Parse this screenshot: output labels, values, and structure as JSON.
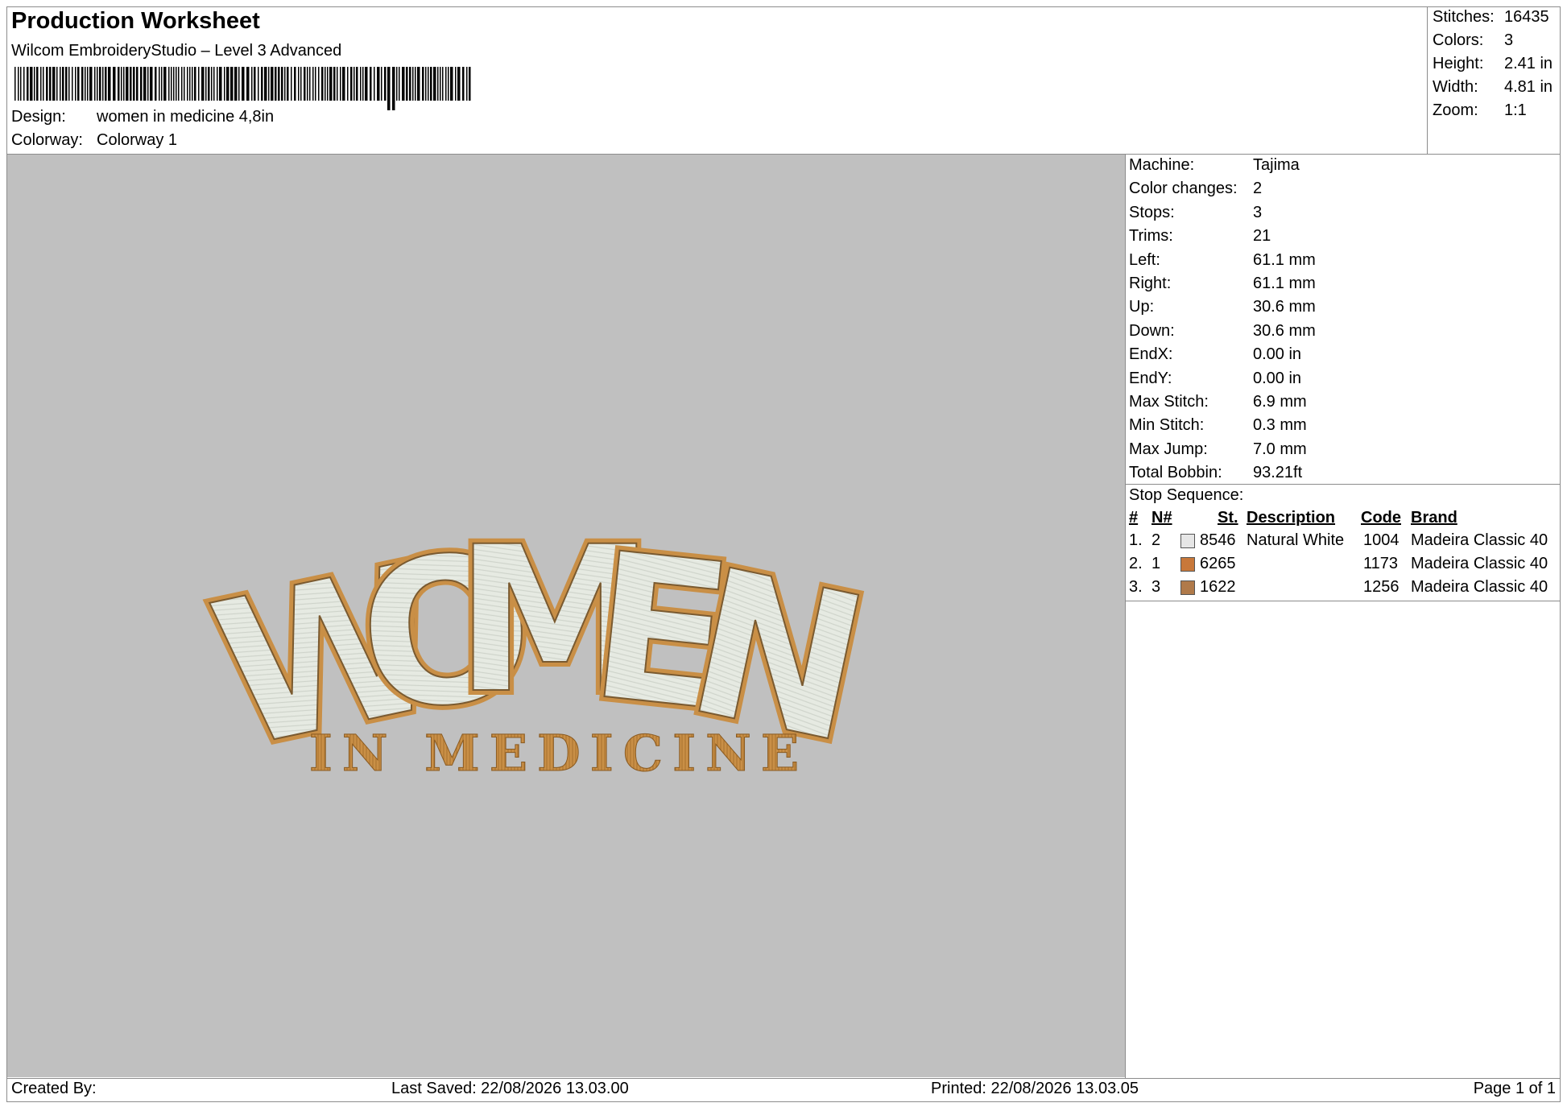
{
  "header": {
    "title": "Production Worksheet",
    "software": "Wilcom EmbroideryStudio – Level 3 Advanced",
    "design_label": "Design:",
    "design_value": "women in medicine 4,8in",
    "colorway_label": "Colorway:",
    "colorway_value": "Colorway 1"
  },
  "summary": [
    {
      "label": "Stitches:",
      "value": "16435"
    },
    {
      "label": "Colors:",
      "value": "3"
    },
    {
      "label": "Height:",
      "value": "2.41 in"
    },
    {
      "label": "Width:",
      "value": "4.81 in"
    },
    {
      "label": "Zoom:",
      "value": "1:1"
    }
  ],
  "machine_info": [
    {
      "label": "Machine:",
      "value": "Tajima"
    },
    {
      "label": "Color changes:",
      "value": "2"
    },
    {
      "label": "Stops:",
      "value": "3"
    },
    {
      "label": "Trims:",
      "value": "21"
    },
    {
      "label": "Left:",
      "value": "61.1 mm"
    },
    {
      "label": "Right:",
      "value": "61.1 mm"
    },
    {
      "label": "Up:",
      "value": "30.6 mm"
    },
    {
      "label": "Down:",
      "value": "30.6 mm"
    },
    {
      "label": "EndX:",
      "value": "0.00 in"
    },
    {
      "label": "EndY:",
      "value": "0.00 in"
    },
    {
      "label": "Max Stitch:",
      "value": "6.9 mm"
    },
    {
      "label": "Min Stitch:",
      "value": "0.3 mm"
    },
    {
      "label": "Max Jump:",
      "value": "7.0 mm"
    },
    {
      "label": "Total Bobbin:",
      "value": "93.21ft"
    }
  ],
  "stop_sequence": {
    "title": "Stop Sequence:",
    "columns": {
      "num": "#",
      "n": "N#",
      "st": "St.",
      "desc": "Description",
      "code": "Code",
      "brand": "Brand"
    },
    "rows": [
      {
        "num": "1.",
        "n": "2",
        "color": "#e6e6e6",
        "st": "8546",
        "desc": "Natural White",
        "code": "1004",
        "brand": "Madeira Classic 40"
      },
      {
        "num": "2.",
        "n": "1",
        "color": "#c8783a",
        "st": "6265",
        "desc": "",
        "code": "1173",
        "brand": "Madeira Classic 40"
      },
      {
        "num": "3.",
        "n": "3",
        "color": "#b07a4a",
        "st": "1622",
        "desc": "",
        "code": "1256",
        "brand": "Madeira Classic 40"
      }
    ]
  },
  "design": {
    "main_text": "WOMEN",
    "sub_text": "IN MEDICINE",
    "fill_color": "#e4e8e0",
    "outline_color": "#c98f46",
    "canvas_color": "#c0c0c0"
  },
  "footer": {
    "created_by": "Created By:",
    "last_saved": "Last Saved: 22/08/2026 13.03.00",
    "printed": "Printed: 22/08/2026 13.03.05",
    "page": "Page 1 of 1"
  }
}
